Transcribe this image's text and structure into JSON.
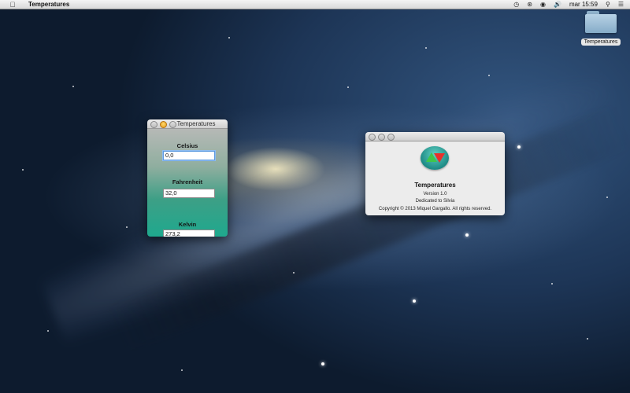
{
  "menubar": {
    "app_name": "Temperatures",
    "icons": [
      "apple-icon",
      "time-machine-icon",
      "bluetooth-icon",
      "wifi-icon",
      "volume-icon",
      "spotlight-icon",
      "list-icon"
    ],
    "clock": "mar 15:59"
  },
  "desktop": {
    "icon_label": "Temperatures"
  },
  "converter": {
    "title": "Temperatures",
    "celsius_label": "Celsius",
    "celsius_value": "0,0",
    "fahrenheit_label": "Fahrenheit",
    "fahrenheit_value": "32,0",
    "kelvin_label": "Kelvin",
    "kelvin_value": "273,2"
  },
  "about": {
    "app_name": "Temperatures",
    "version": "Version 1.0",
    "dedication": "Dedicated to Silvia",
    "copyright": "Copyright © 2013 Miquel Gargallo. All rights reserved."
  },
  "colors": {
    "gradient_top": "#b6b9b6",
    "gradient_bottom": "#1ea98e",
    "focus_ring": "#5c9ae0"
  }
}
